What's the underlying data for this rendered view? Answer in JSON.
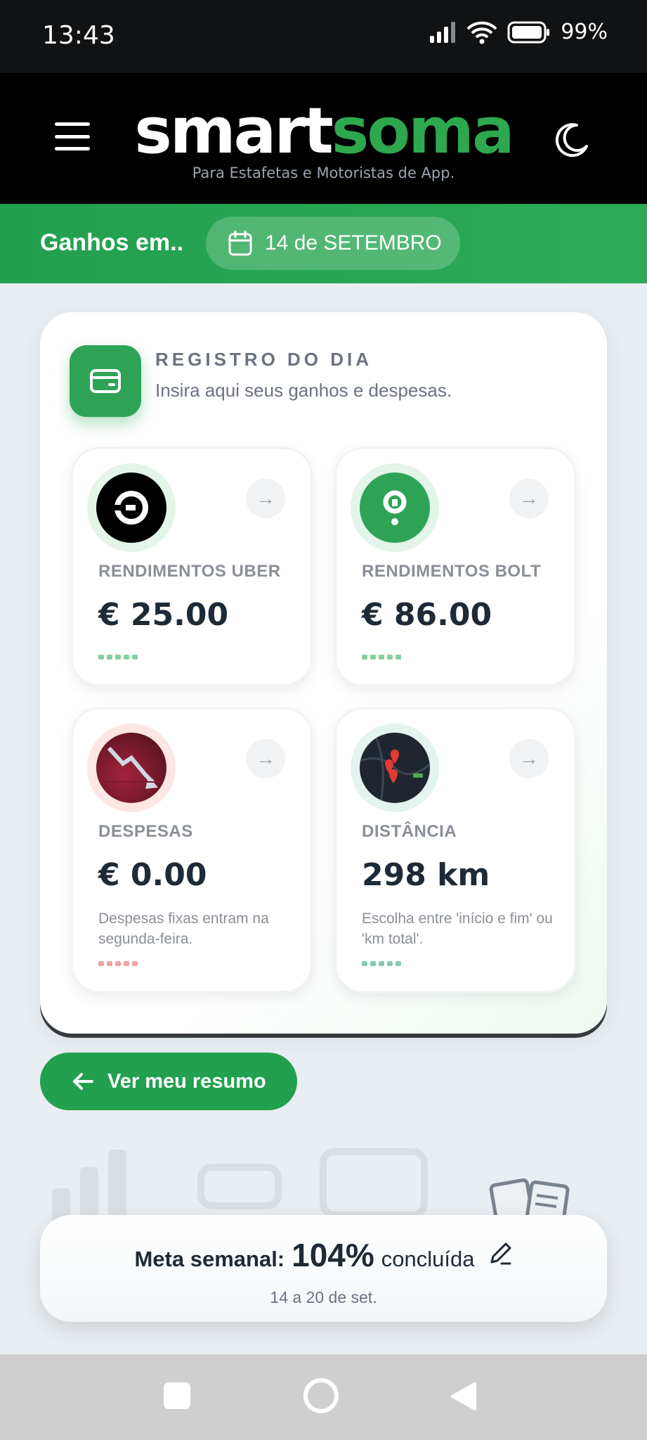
{
  "status_bar": {
    "time": "13:43",
    "battery": "99%",
    "signal_icon": "signal-icon",
    "wifi_icon": "wifi-icon",
    "battery_icon": "battery-icon"
  },
  "header": {
    "logo_part1": "smart",
    "logo_part2": "soma",
    "tagline": "Para Estafetas e Motoristas de App.",
    "menu_icon": "hamburger-menu-icon",
    "theme_icon": "moon-icon",
    "brand_color": "#2ea84f"
  },
  "date_bar": {
    "label": "Ganhos em..",
    "date": "14 de SETEMBRO",
    "icon": "calendar-icon"
  },
  "register": {
    "title": "REGISTRO DO DIA",
    "subtitle": "Insira aqui seus ganhos e despesas.",
    "icon": "wallet-icon"
  },
  "tiles": [
    {
      "label": "RENDIMENTOS UBER",
      "value": "€ 25.00",
      "note": "",
      "icon": "uber-logo-icon"
    },
    {
      "label": "RENDIMENTOS BOLT",
      "value": "€ 86.00",
      "note": "",
      "icon": "bolt-logo-icon"
    },
    {
      "label": "DESPESAS",
      "value": "€ 0.00",
      "note": "Despesas fixas entram na segunda-feira.",
      "icon": "expenses-chart-icon"
    },
    {
      "label": "DISTÂNCIA",
      "value": "298 km",
      "note": "Escolha entre 'início e fim' ou 'km total'.",
      "icon": "map-pin-icon"
    }
  ],
  "summary_button": {
    "label": "Ver meu resumo",
    "icon": "arrow-left-icon"
  },
  "weekly_goal": {
    "prefix": "Meta semanal:",
    "percent": "104%",
    "suffix": "concluída",
    "range": "14 a 20 de set.",
    "edit_icon": "pencil-icon"
  },
  "nav": {
    "recent_icon": "square-icon",
    "home_icon": "circle-icon",
    "back_icon": "triangle-back-icon"
  }
}
